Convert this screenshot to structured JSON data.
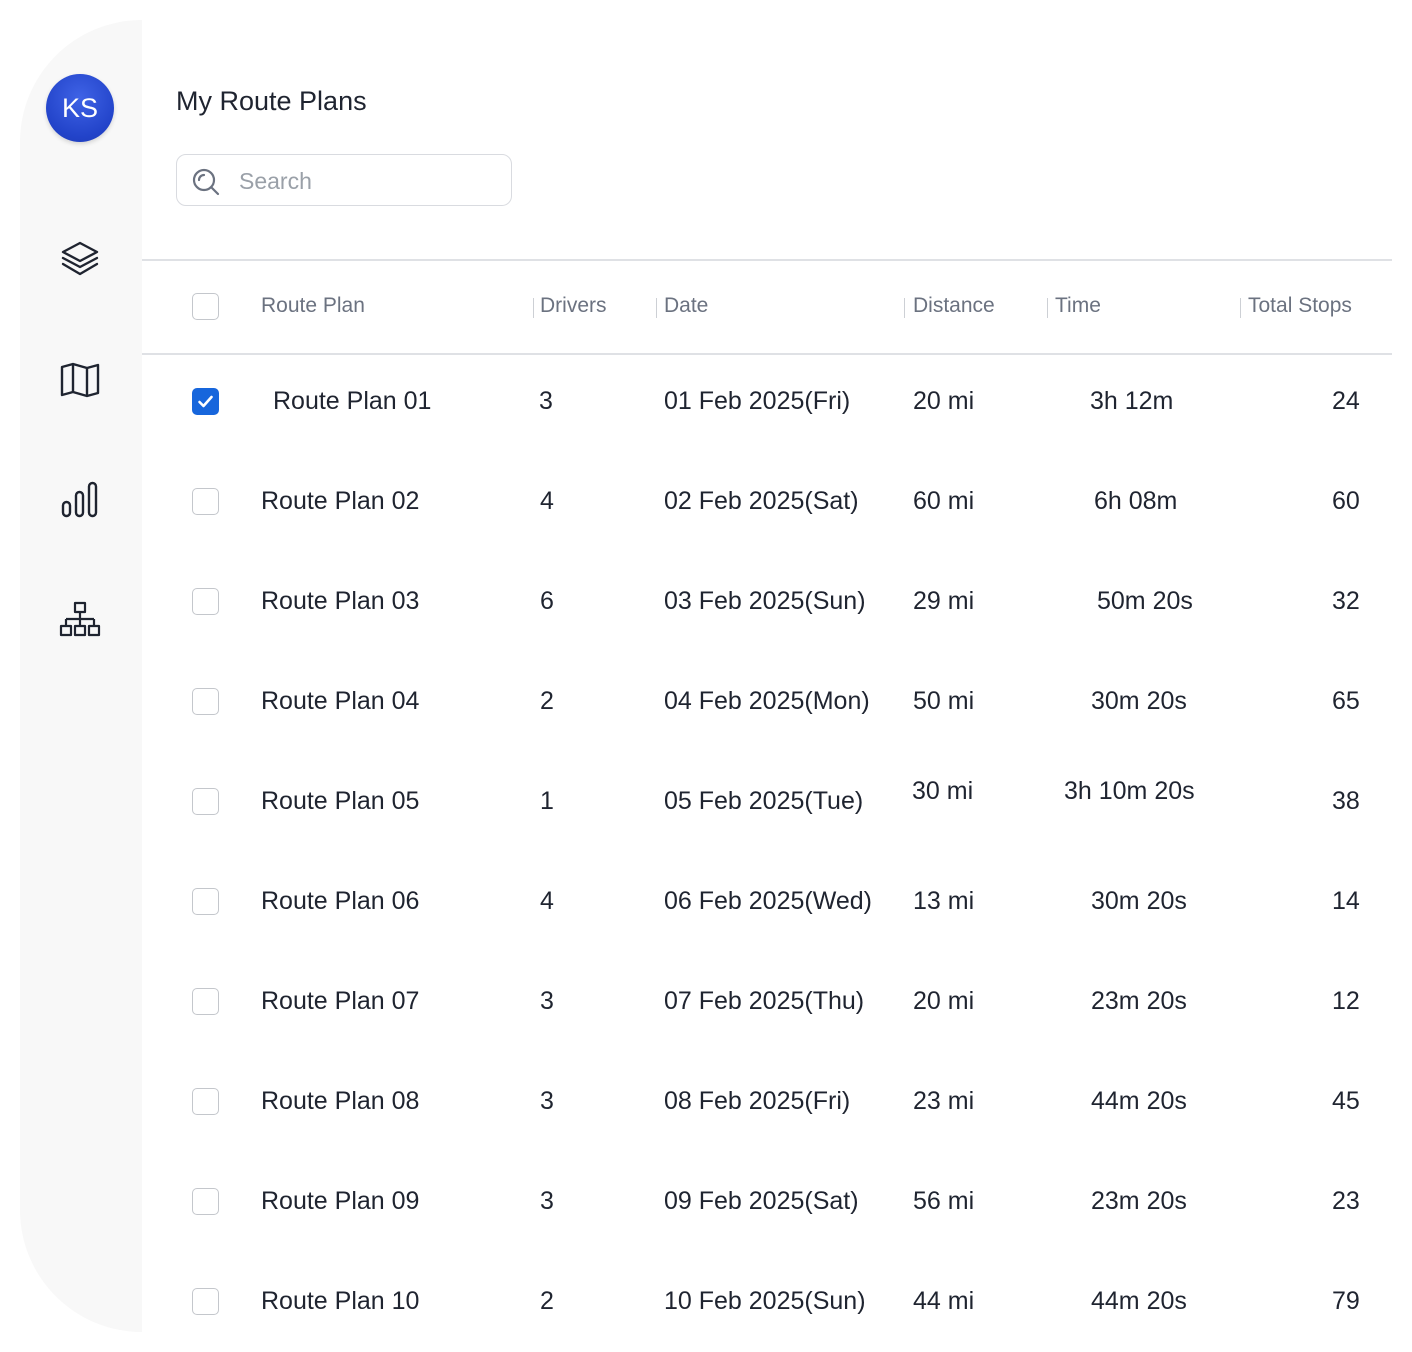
{
  "user": {
    "initials": "KS"
  },
  "sidebar": {
    "icons": [
      "layers-icon",
      "map-icon",
      "bar-chart-icon",
      "hierarchy-icon"
    ]
  },
  "page": {
    "title": "My Route Plans"
  },
  "search": {
    "placeholder": "Search",
    "value": ""
  },
  "table": {
    "columns": [
      "Route Plan",
      "Drivers",
      "Date",
      "Distance",
      "Time",
      "Total Stops"
    ],
    "rows": [
      {
        "selected": true,
        "route_plan": "Route Plan 01",
        "drivers": "3",
        "date": "01 Feb 2025(Fri)",
        "distance": "20 mi",
        "time": "3h 12m",
        "total_stops": "24"
      },
      {
        "selected": false,
        "route_plan": "Route Plan 02",
        "drivers": "4",
        "date": "02 Feb 2025(Sat)",
        "distance": "60 mi",
        "time": "6h 08m",
        "total_stops": "60"
      },
      {
        "selected": false,
        "route_plan": "Route Plan 03",
        "drivers": "6",
        "date": "03 Feb 2025(Sun)",
        "distance": "29 mi",
        "time": "50m 20s",
        "total_stops": "32"
      },
      {
        "selected": false,
        "route_plan": "Route Plan 04",
        "drivers": "2",
        "date": "04 Feb 2025(Mon)",
        "distance": "50 mi",
        "time": "30m 20s",
        "total_stops": "65"
      },
      {
        "selected": false,
        "route_plan": "Route Plan 05",
        "drivers": "1",
        "date": "05 Feb 2025(Tue)",
        "distance": "30 mi",
        "time": "3h 10m 20s",
        "total_stops": "38"
      },
      {
        "selected": false,
        "route_plan": "Route Plan 06",
        "drivers": "4",
        "date": "06 Feb 2025(Wed)",
        "distance": "13 mi",
        "time": "30m 20s",
        "total_stops": "14"
      },
      {
        "selected": false,
        "route_plan": "Route Plan 07",
        "drivers": "3",
        "date": "07 Feb 2025(Thu)",
        "distance": "20 mi",
        "time": "23m 20s",
        "total_stops": "12"
      },
      {
        "selected": false,
        "route_plan": "Route Plan 08",
        "drivers": "3",
        "date": "08 Feb 2025(Fri)",
        "distance": "23 mi",
        "time": "44m 20s",
        "total_stops": "45"
      },
      {
        "selected": false,
        "route_plan": "Route Plan 09",
        "drivers": "3",
        "date": "09 Feb 2025(Sat)",
        "distance": "56 mi",
        "time": "23m 20s",
        "total_stops": "23"
      },
      {
        "selected": false,
        "route_plan": "Route Plan 10",
        "drivers": "2",
        "date": "10 Feb 2025(Sun)",
        "distance": "44 mi",
        "time": "44m 20s",
        "total_stops": "79"
      }
    ]
  },
  "colors": {
    "accent": "#1766dc",
    "avatar": "#2a4bd6",
    "sidebar_bg": "#f8f8f8"
  }
}
